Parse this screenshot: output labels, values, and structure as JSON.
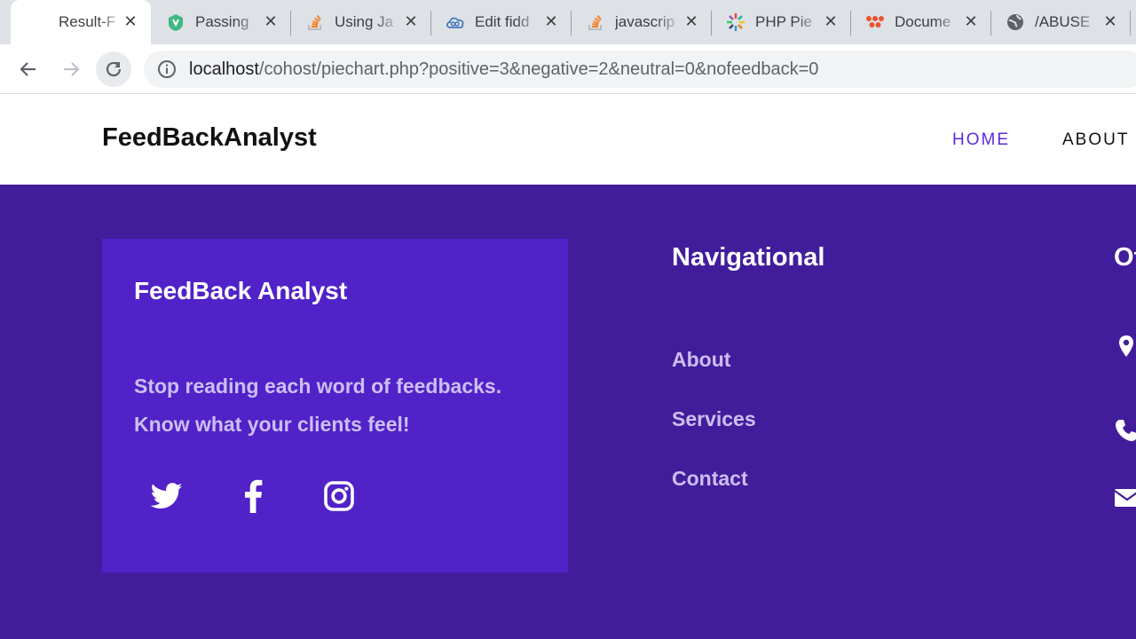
{
  "browser": {
    "tabs": [
      {
        "title": "Result-F",
        "active": true,
        "icon": "page-icon"
      },
      {
        "title": "Passing",
        "active": false,
        "icon": "vue-icon"
      },
      {
        "title": "Using Ja",
        "active": false,
        "icon": "stackoverflow-icon"
      },
      {
        "title": "Edit fidd",
        "active": false,
        "icon": "jsfiddle-icon"
      },
      {
        "title": "javascrip",
        "active": false,
        "icon": "stackoverflow-icon"
      },
      {
        "title": "PHP Pie",
        "active": false,
        "icon": "php-chart-icon"
      },
      {
        "title": "Docume",
        "active": false,
        "icon": "docs-icon"
      },
      {
        "title": "/ABUSE",
        "active": false,
        "icon": "globe-icon"
      }
    ],
    "url_host": "localhost",
    "url_path": "/cohost/piechart.php?positive=3&negative=2&neutral=0&nofeedback=0"
  },
  "site": {
    "brand": "FeedBackAnalyst",
    "nav": {
      "home": "HOME",
      "about": "ABOUT"
    }
  },
  "footer": {
    "card_title": "FeedBack Analyst",
    "tagline_1": "Stop reading each word of feedbacks.",
    "tagline_2": "Know what your clients feel!",
    "social": [
      "twitter-icon",
      "facebook-icon",
      "instagram-icon"
    ],
    "nav_title": "Navigational",
    "nav_items": [
      "About",
      "Services",
      "Contact"
    ],
    "office_title_partial": "Of",
    "office_icons": [
      "map-marker-icon",
      "phone-icon",
      "envelope-icon"
    ]
  },
  "colors": {
    "footer_bg": "#421d9b",
    "card_bg": "#5022c8",
    "accent": "#5b2bd7",
    "muted_text": "#cdbef2"
  }
}
